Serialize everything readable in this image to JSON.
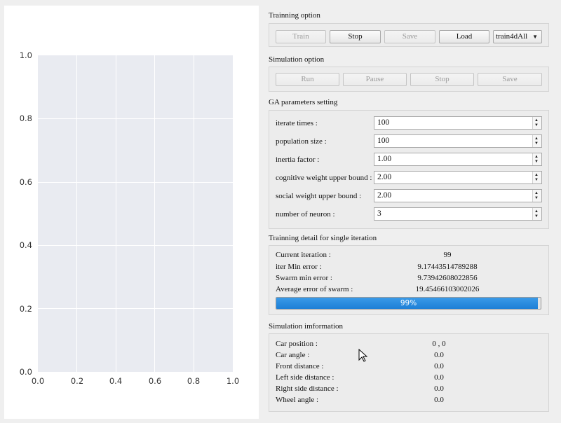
{
  "plot": {
    "y_ticks": [
      "1.0",
      "0.8",
      "0.6",
      "0.4",
      "0.2",
      "0.0"
    ],
    "x_ticks": [
      "0.0",
      "0.2",
      "0.4",
      "0.6",
      "0.8",
      "1.0"
    ],
    "xlim": [
      0,
      1
    ],
    "ylim": [
      0,
      1
    ],
    "grid": true,
    "background": "#e9ebf1"
  },
  "training_option": {
    "title": "Trainning option",
    "train_label": "Train",
    "stop_label": "Stop",
    "save_label": "Save",
    "load_label": "Load",
    "dataset_selected": "train4dAll"
  },
  "simulation_option": {
    "title": "Simulation option",
    "run_label": "Run",
    "pause_label": "Pause",
    "stop_label": "Stop",
    "save_label": "Save"
  },
  "ga_parameters": {
    "title": "GA parameters setting",
    "iterate_times_label": "iterate times :",
    "iterate_times_value": "100",
    "population_size_label": "population size :",
    "population_size_value": "100",
    "inertia_factor_label": "inertia factor :",
    "inertia_factor_value": "1.00",
    "cognitive_weight_label": "cognitive weight upper bound :",
    "cognitive_weight_value": "2.00",
    "social_weight_label": "social weight upper bound :",
    "social_weight_value": "2.00",
    "number_of_neuron_label": "number of neuron :",
    "number_of_neuron_value": "3"
  },
  "training_detail": {
    "title": "Trainning detail for single iteration",
    "current_iteration_label": "Current iteration :",
    "current_iteration_value": "99",
    "iter_min_error_label": "iter Min error :",
    "iter_min_error_value": "9.17443514789288",
    "swarm_min_error_label": "Swarm min error :",
    "swarm_min_error_value": "9.73942608022856",
    "average_error_label": "Average error of swarm :",
    "average_error_value": "19.45466103002026",
    "progress_percent": 99,
    "progress_text": "99%",
    "progress_color": "#1d7fd6"
  },
  "simulation_information": {
    "title": "Simulation imformation",
    "car_position_label": "Car position :",
    "car_position_value": "0 , 0",
    "car_angle_label": "Car angle :",
    "car_angle_value": "0.0",
    "front_distance_label": "Front distance :",
    "front_distance_value": "0.0",
    "left_distance_label": "Left side distance :",
    "left_distance_value": "0.0",
    "right_distance_label": "Right side distance :",
    "right_distance_value": "0.0",
    "wheel_angle_label": "Wheel angle :",
    "wheel_angle_value": "0.0"
  }
}
